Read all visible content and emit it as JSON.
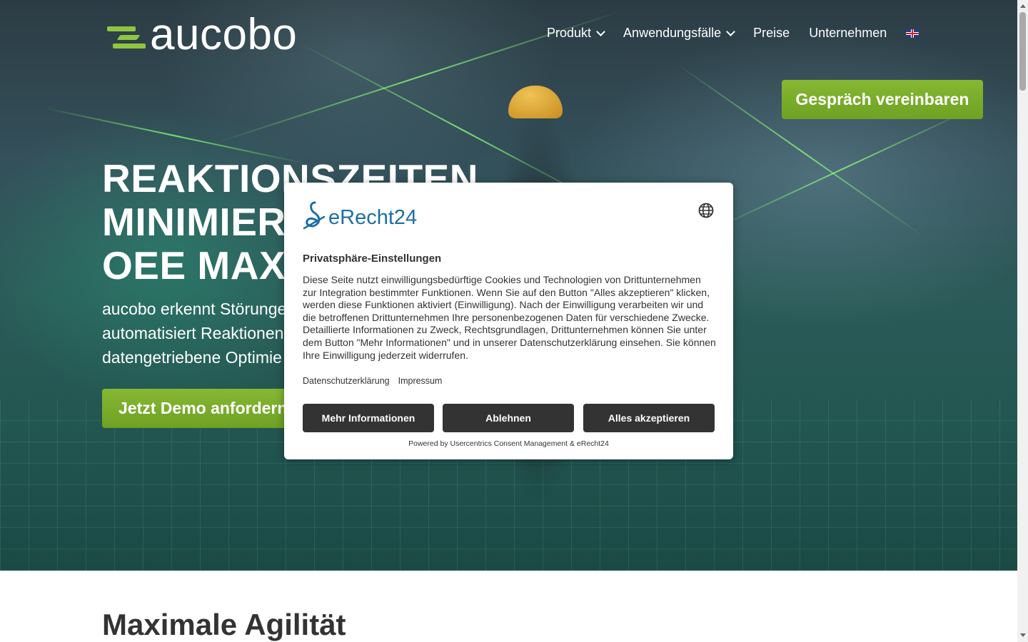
{
  "brand": {
    "logo_text": "aucobo",
    "accent": "#8fc63e"
  },
  "nav": {
    "items": [
      {
        "label": "Produkt",
        "has_dropdown": true
      },
      {
        "label": "Anwendungsfälle",
        "has_dropdown": true
      },
      {
        "label": "Preise",
        "has_dropdown": false
      },
      {
        "label": "Unternehmen",
        "has_dropdown": false
      }
    ],
    "language_icon": "uk-flag-icon"
  },
  "header_cta": {
    "label": "Gespräch vereinbaren"
  },
  "hero": {
    "title_lines": [
      "REAKTIONSZEITEN",
      "MINIMIERE",
      "OEE MAXIM"
    ],
    "subtitle_lines": [
      "aucobo erkennt Störunge",
      "automatisiert Reaktionen",
      "datengetriebene Optimie"
    ],
    "cta_label": "Jetzt Demo anfordern"
  },
  "section": {
    "title": "Maximale Agilität"
  },
  "consent": {
    "logo_text": "eRecht24",
    "title": "Privatsphäre-Einstellungen",
    "body": "Diese Seite nutzt einwilligungsbedürftige Cookies und Technologien von Drittunternehmen zur Integration bestimmter Funktionen. Wenn Sie auf den Button \"Alles akzeptieren\" klicken, werden diese Funktionen aktiviert (Einwilligung). Nach der Einwilligung verarbeiten wir und die betroffenen Drittunternehmen Ihre personenbezogenen Daten für verschiedene Zwecke. Detaillierte Informationen zu Zweck, Rechtsgrundlagen, Drittunternehmen können Sie unter dem Button \"Mehr Informationen\" und in unserer Datenschutzerklärung einsehen. Sie können Ihre Einwilligung jederzeit widerrufen.",
    "links": {
      "privacy": "Datenschutzerklärung",
      "imprint": "Impressum"
    },
    "buttons": {
      "more": "Mehr Informationen",
      "decline": "Ablehnen",
      "accept": "Alles akzeptieren"
    },
    "powered_by": "Powered by Usercentrics Consent Management & eRecht24",
    "language_icon": "globe-icon",
    "button_color": "#333333"
  }
}
